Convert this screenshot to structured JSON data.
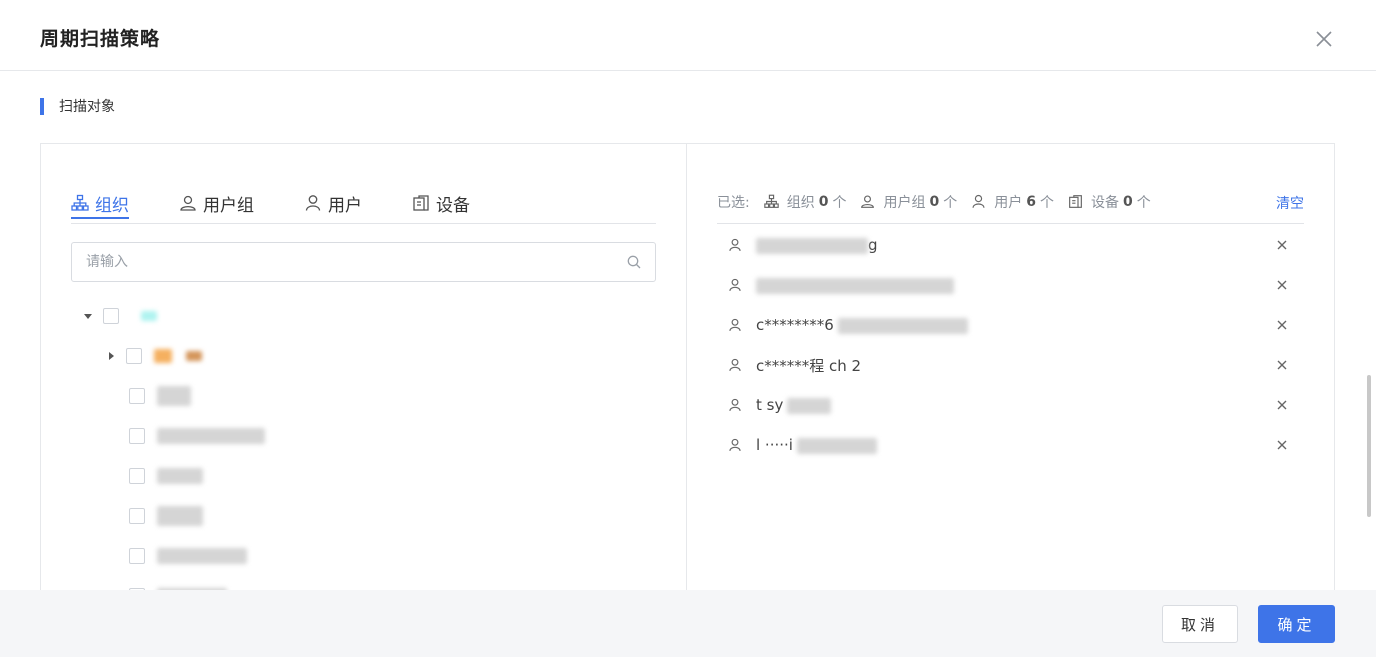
{
  "dialog": {
    "title": "周期扫描策略",
    "close_icon": "close-icon"
  },
  "section": {
    "title": "扫描对象"
  },
  "tabs": [
    {
      "label": "组织",
      "icon": "org-tree-icon",
      "active": true
    },
    {
      "label": "用户组",
      "icon": "user-group-icon",
      "active": false
    },
    {
      "label": "用户",
      "icon": "user-icon",
      "active": false
    },
    {
      "label": "设备",
      "icon": "device-icon",
      "active": false
    }
  ],
  "search": {
    "placeholder": "请输入",
    "value": ""
  },
  "selected_summary": {
    "prefix": "已选:",
    "org_label": "组织",
    "org_count": "0",
    "group_label": "用户组",
    "group_count": "0",
    "user_label": "用户",
    "user_count": "6",
    "device_label": "设备",
    "device_count": "0",
    "unit": "个",
    "clear_label": "清空"
  },
  "selected_users": [
    {
      "name": "g"
    },
    {
      "name": ""
    },
    {
      "name": "c********6"
    },
    {
      "name": "c******程 ch 2"
    },
    {
      "name": "t sy"
    },
    {
      "name": "l ·····i"
    }
  ],
  "footer": {
    "cancel_label": "取消",
    "ok_label": "确定"
  },
  "colors": {
    "accent": "#3e74e8",
    "border": "#e6e8eb",
    "footer_bg": "#f5f6f8"
  }
}
